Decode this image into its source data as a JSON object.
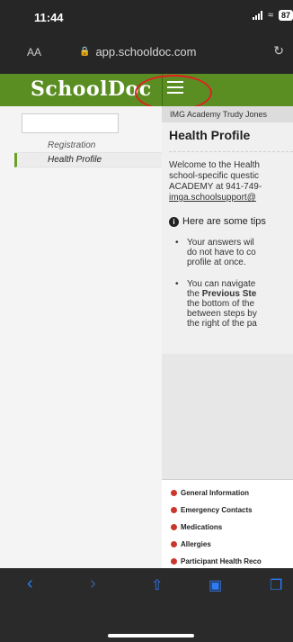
{
  "status_bar": {
    "time": "11:44",
    "battery": "87"
  },
  "url_bar": {
    "text_size": "AA",
    "url": "app.schooldoc.com"
  },
  "header": {
    "brand": "SchoolDoc"
  },
  "sidebar": {
    "items": [
      {
        "label": "Registration"
      },
      {
        "label": "Health Profile"
      }
    ]
  },
  "main": {
    "breadcrumb": "IMG Academy Trudy Jones",
    "title": "Health Profile",
    "intro_lines": [
      "Welcome to the Health",
      "school-specific questic",
      "ACADEMY at 941-749-",
      "imga.schoolsupport@"
    ],
    "tips_heading": "Here are some tips",
    "tip1_lines": [
      "Your answers wil",
      "do not have to co",
      "profile at once."
    ],
    "tip2_lines": [
      "You can navigate",
      "the Previous Ste",
      "the bottom of the",
      "between steps by",
      "the right of the pa"
    ],
    "steps": [
      {
        "label": "General Information"
      },
      {
        "label": "Emergency Contacts"
      },
      {
        "label": "Medications"
      },
      {
        "label": "Allergies"
      },
      {
        "label": "Participant Health Reco"
      }
    ]
  }
}
